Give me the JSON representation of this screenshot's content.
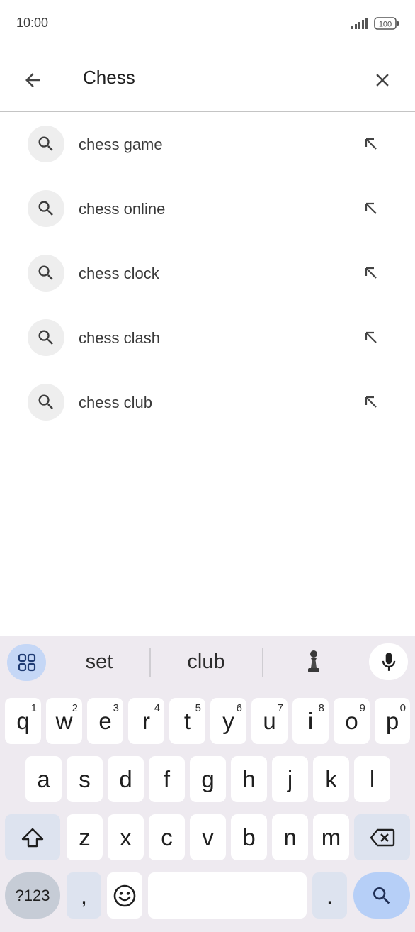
{
  "status_bar": {
    "time": "10:00",
    "battery": "100"
  },
  "search": {
    "query": "Chess"
  },
  "suggestions": [
    {
      "text": "chess game"
    },
    {
      "text": "chess online"
    },
    {
      "text": "chess clock"
    },
    {
      "text": "chess clash"
    },
    {
      "text": "chess club"
    }
  ],
  "keyboard": {
    "word_suggestions": [
      "set",
      "club"
    ],
    "row1": [
      {
        "key": "q",
        "num": "1"
      },
      {
        "key": "w",
        "num": "2"
      },
      {
        "key": "e",
        "num": "3"
      },
      {
        "key": "r",
        "num": "4"
      },
      {
        "key": "t",
        "num": "5"
      },
      {
        "key": "y",
        "num": "6"
      },
      {
        "key": "u",
        "num": "7"
      },
      {
        "key": "i",
        "num": "8"
      },
      {
        "key": "o",
        "num": "9"
      },
      {
        "key": "p",
        "num": "0"
      }
    ],
    "row2": [
      "a",
      "s",
      "d",
      "f",
      "g",
      "h",
      "j",
      "k",
      "l"
    ],
    "row3": [
      "z",
      "x",
      "c",
      "v",
      "b",
      "n",
      "m"
    ],
    "symbols_key": "?123",
    "comma_key": ",",
    "period_key": "."
  }
}
